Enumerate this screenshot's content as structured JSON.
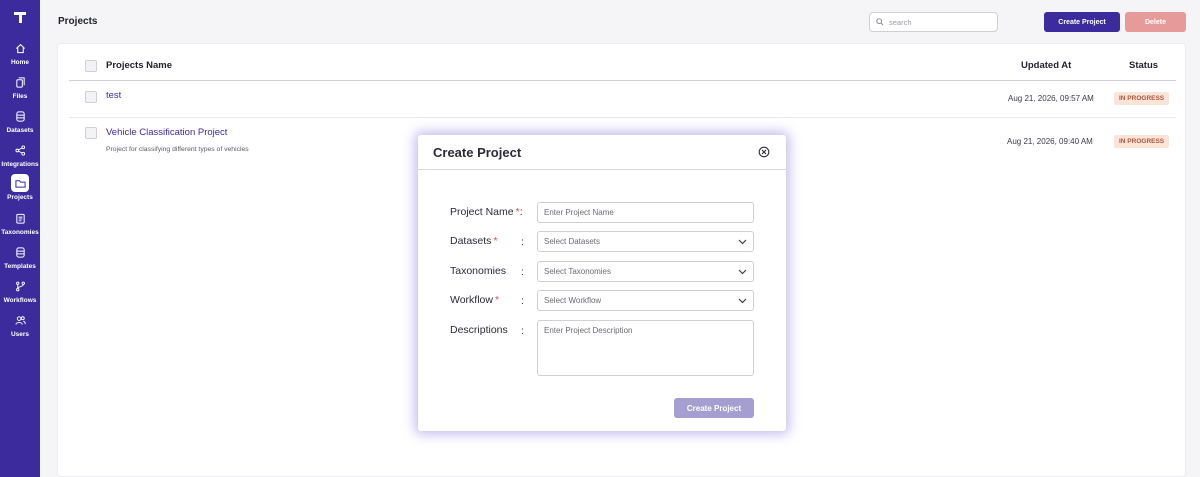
{
  "sidebar": {
    "items": [
      {
        "label": "Home",
        "icon": "home-icon"
      },
      {
        "label": "Files",
        "icon": "files-icon"
      },
      {
        "label": "Datasets",
        "icon": "database-icon"
      },
      {
        "label": "Integrations",
        "icon": "share-icon"
      },
      {
        "label": "Projects",
        "icon": "folder-icon",
        "active": true
      },
      {
        "label": "Taxonomies",
        "icon": "clipboard-icon"
      },
      {
        "label": "Templates",
        "icon": "database-icon"
      },
      {
        "label": "Workflows",
        "icon": "branch-icon"
      },
      {
        "label": "Users",
        "icon": "users-icon"
      }
    ]
  },
  "header": {
    "title": "Projects",
    "search_placeholder": "search",
    "create_label": "Create Project",
    "delete_label": "Delete"
  },
  "table": {
    "columns": {
      "name": "Projects Name",
      "updated": "Updated At",
      "status": "Status"
    },
    "rows": [
      {
        "name": "test",
        "description": "",
        "updated_at": "Aug 21, 2026, 09:57 AM",
        "status": "IN PROGRESS"
      },
      {
        "name": "Vehicle Classification Project",
        "description": "Project for classifying different types of vehicles",
        "updated_at": "Aug 21, 2026, 09:40 AM",
        "status": "IN PROGRESS"
      }
    ]
  },
  "modal": {
    "title": "Create Project",
    "required_mark": "*",
    "colon": ":",
    "fields": {
      "name": {
        "label": "Project Name",
        "placeholder": "Enter Project Name"
      },
      "datasets": {
        "label": "Datasets",
        "placeholder": "Select Datasets"
      },
      "taxonomies": {
        "label": "Taxonomies",
        "placeholder": "Select Taxonomies"
      },
      "workflow": {
        "label": "Workflow",
        "placeholder": "Select Workflow"
      },
      "descriptions": {
        "label": "Descriptions",
        "placeholder": "Enter Project Description"
      }
    },
    "submit_label": "Create Project"
  },
  "colors": {
    "brand": "#3b2b9c",
    "danger": "#e79a9a",
    "status_bg": "#fbe4d8",
    "status_text": "#b0563a"
  }
}
